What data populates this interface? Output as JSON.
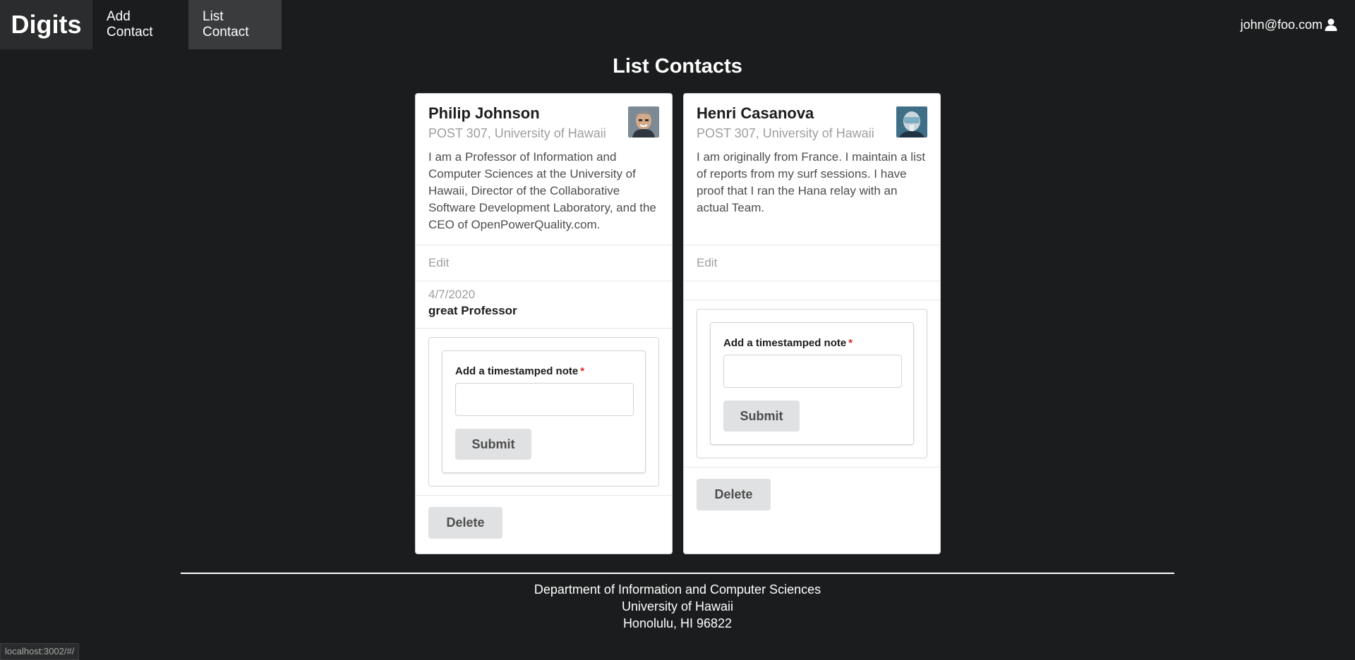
{
  "nav": {
    "brand": "Digits",
    "items": [
      {
        "label": "Add Contact",
        "active": false
      },
      {
        "label": "List Contact",
        "active": true
      }
    ],
    "user": "john@foo.com",
    "user_icon": "user-icon"
  },
  "page": {
    "title": "List Contacts"
  },
  "contacts": [
    {
      "name": "Philip Johnson",
      "address": "POST 307, University of Hawaii",
      "description": "I am a Professor of Information and Computer Sciences at the University of Hawaii, Director of the Collaborative Software Development Laboratory, and the CEO of OpenPowerQuality.com.",
      "edit_label": "Edit",
      "notes": [
        {
          "date": "4/7/2020",
          "text": "great Professor"
        }
      ],
      "form": {
        "label": "Add a timestamped note",
        "required_mark": "*",
        "submit_label": "Submit"
      },
      "delete_label": "Delete"
    },
    {
      "name": "Henri Casanova",
      "address": "POST 307, University of Hawaii",
      "description": "I am originally from France. I maintain a list of reports from my surf sessions. I have proof that I ran the Hana relay with an actual Team.",
      "edit_label": "Edit",
      "notes": [],
      "form": {
        "label": "Add a timestamped note",
        "required_mark": "*",
        "submit_label": "Submit"
      },
      "delete_label": "Delete"
    }
  ],
  "footer": {
    "line1": "Department of Information and Computer Sciences",
    "line2": "University of Hawaii",
    "line3": "Honolulu, HI 96822"
  },
  "status_bar": "localhost:3002/#/"
}
